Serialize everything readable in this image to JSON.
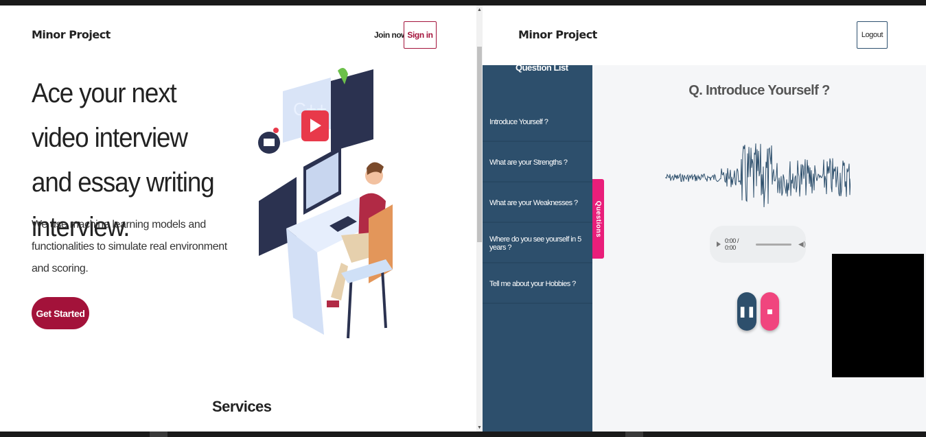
{
  "left": {
    "brand": "Minor Project",
    "nav": {
      "join": "Join now",
      "signin": "Sign in"
    },
    "hero": {
      "headline": "Ace your next video interview and essay writing interview.",
      "description": "We use machine learning models and functionalities to simulate real environment and scoring.",
      "cta": "Get Started"
    },
    "services_heading": "Services"
  },
  "right": {
    "brand": "Minor Project",
    "logout": "Logout",
    "sidebar": {
      "title": "Question List",
      "items": [
        {
          "label": "Introduce Yourself ?"
        },
        {
          "label": "What are your Strengths ?"
        },
        {
          "label": "What are your Weaknesses ?"
        },
        {
          "label": "Where do you see yourself in 5 years ?"
        },
        {
          "label": "Tell me about your Hobbies ?"
        }
      ],
      "toggle_label": "Questions"
    },
    "question": "Q. Introduce Yourself ?",
    "audio": {
      "time": "0:00 / 0:00"
    },
    "colors": {
      "primary": "#2d4f6c",
      "accent": "#e91e7a",
      "brand_red": "#a3123a"
    }
  }
}
